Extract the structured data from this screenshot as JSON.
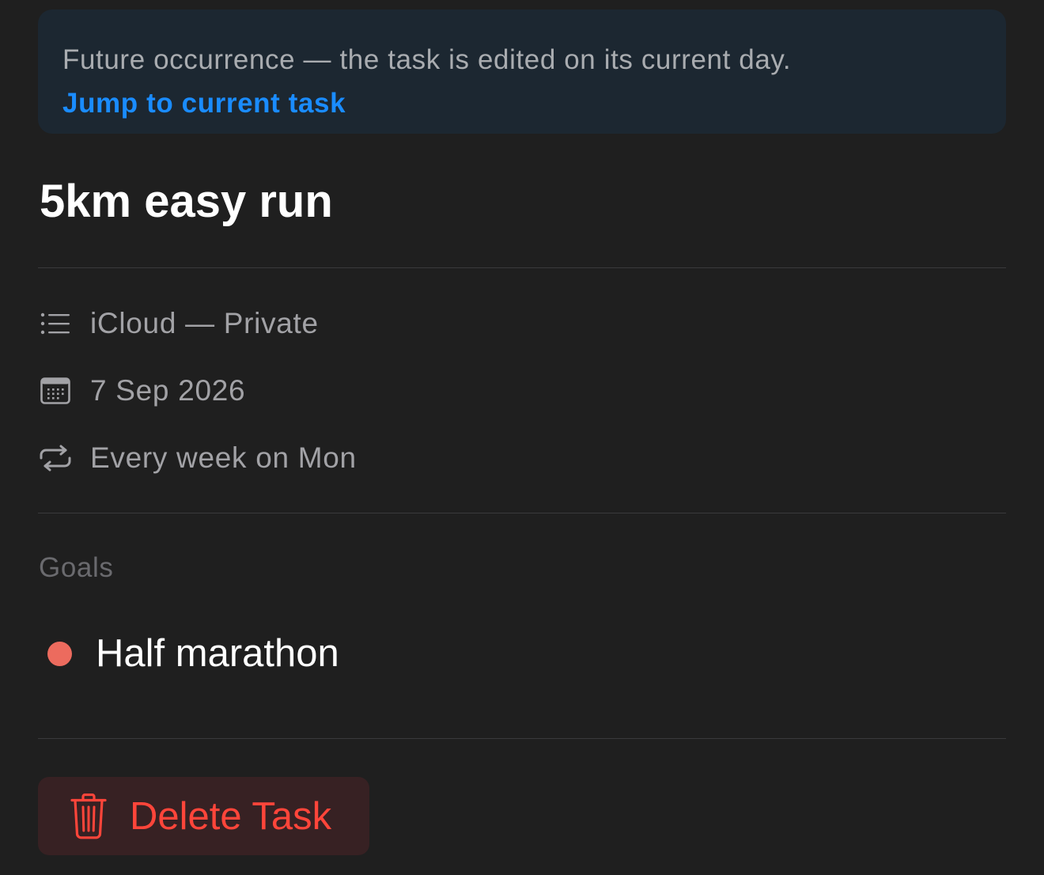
{
  "banner": {
    "message": "Future occurrence — the task is edited on its current day.",
    "link_label": "Jump to current task"
  },
  "task": {
    "title": "5km easy run"
  },
  "details": {
    "list": {
      "icon": "list-icon",
      "label": "iCloud — Private"
    },
    "date": {
      "icon": "calendar-icon",
      "label": "7 Sep 2026"
    },
    "repeat": {
      "icon": "repeat-icon",
      "label": "Every week on Mon"
    }
  },
  "goals": {
    "section_label": "Goals",
    "items": [
      {
        "label": "Half marathon",
        "color": "#ec6b5e"
      }
    ]
  },
  "actions": {
    "delete_label": "Delete Task",
    "delete_icon": "trash-icon",
    "delete_color": "#ff453a"
  },
  "colors": {
    "background": "#1f1f1f",
    "banner_background": "#1c2731",
    "link": "#1a8cff",
    "secondary_text": "#a2a2a6"
  }
}
